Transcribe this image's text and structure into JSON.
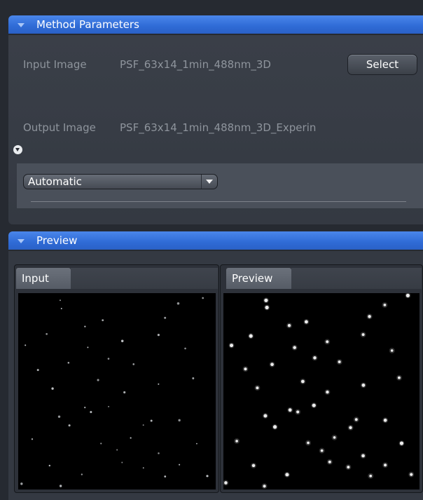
{
  "method_panel": {
    "title": "Method Parameters",
    "input_label": "Input Image",
    "input_value": "PSF_63x14_1min_488nm_3D",
    "select_label": "Select",
    "output_label": "Output Image",
    "output_value": "PSF_63x14_1min_488nm_3D_Experin",
    "mode": "Automatic"
  },
  "preview_panel": {
    "title": "Preview",
    "tabs": [
      "Input",
      "Preview"
    ]
  },
  "colors": {
    "header_blue": "#2f6bd6",
    "background": "#262a31",
    "panel": "#3a3f48"
  }
}
